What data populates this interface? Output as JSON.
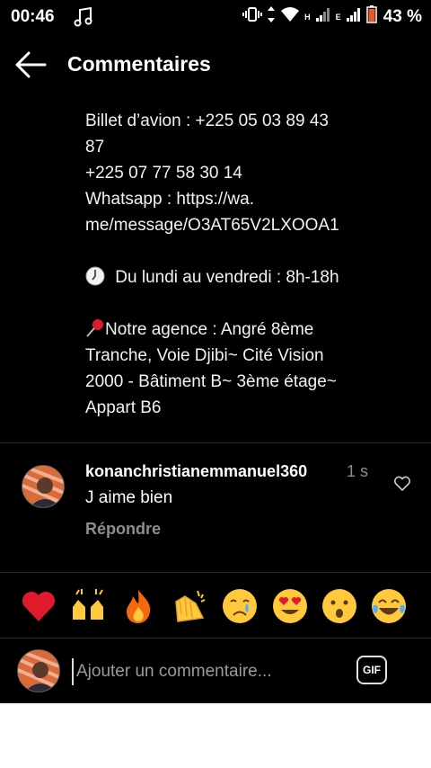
{
  "status_bar": {
    "time": "00:46",
    "network_h": "H",
    "network_e": "E",
    "battery_percent": "43 %"
  },
  "header": {
    "title": "Commentaires"
  },
  "caption": {
    "lines": [
      "Billet d’avion : +225 05 03 89 43",
      "87",
      "+225 07 77 58 30 14",
      "Whatsapp : https://wa.",
      "me/message/O3AT65V2LXOOA1",
      "",
      "Du lundi au vendredi : 8h-18h",
      "",
      "Notre agence : Angré 8ème",
      "Tranche, Voie Djibi~ Cité Vision",
      "2000 - Bâtiment B~ 3ème étage~",
      "Appart B6"
    ]
  },
  "comment": {
    "username": "konanchristianemmanuel360",
    "time": "1 s",
    "text": "J aime bien",
    "reply_label": "Répondre"
  },
  "reactions": [
    "red-heart",
    "raising-hands",
    "fire",
    "clapping-hands",
    "crying-face",
    "heart-eyes-face",
    "astonished-face",
    "tears-of-joy-face"
  ],
  "input": {
    "placeholder": "Ajouter un commentaire...",
    "gif_label": "GIF"
  },
  "colors": {
    "background": "#000000",
    "secondary_text": "#8e8e8e",
    "accent_heart": "#e0192c",
    "emoji_yellow": "#ffc83d"
  }
}
